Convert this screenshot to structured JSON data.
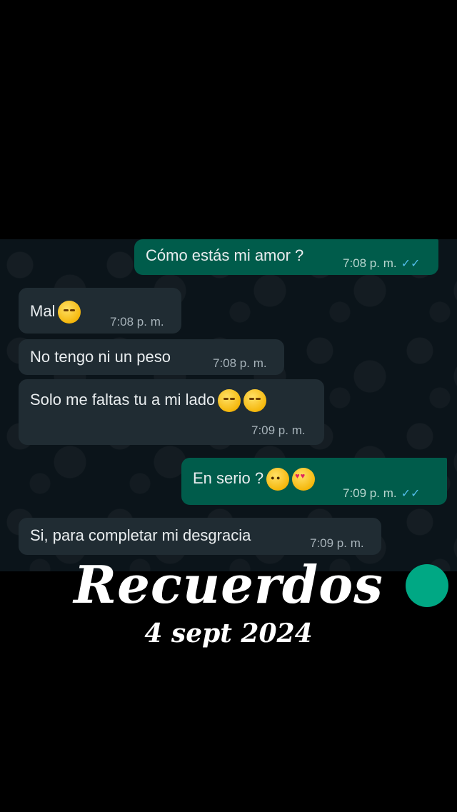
{
  "messages": [
    {
      "side": "out",
      "text": "Cómo estás mi amor ?",
      "time": "7:08 p. m.",
      "ticks": "✓✓"
    },
    {
      "side": "in",
      "text": "Mal",
      "time": "7:08 p. m.",
      "emoji": [
        "pensive-face"
      ]
    },
    {
      "side": "in",
      "text": "No tengo ni un peso",
      "time": "7:08 p. m."
    },
    {
      "side": "in",
      "text": "Solo me faltas tu a mi lado",
      "time": "7:09 p. m.",
      "emoji": [
        "pensive-face",
        "persevering-face"
      ]
    },
    {
      "side": "out",
      "text": "En serio ?",
      "time": "7:09 p. m.",
      "ticks": "✓✓",
      "emoji": [
        "pleading-face",
        "heart-eyes-face"
      ]
    },
    {
      "side": "in",
      "text": "Si, para completar mi desgracia",
      "time": "7:09 p. m."
    }
  ],
  "overlay": {
    "title": "Recuerdos",
    "date": "4 sept 2024"
  },
  "colors": {
    "incoming_bubble": "#202c33",
    "outgoing_bubble": "#005c4b",
    "read_ticks": "#53bdeb"
  }
}
